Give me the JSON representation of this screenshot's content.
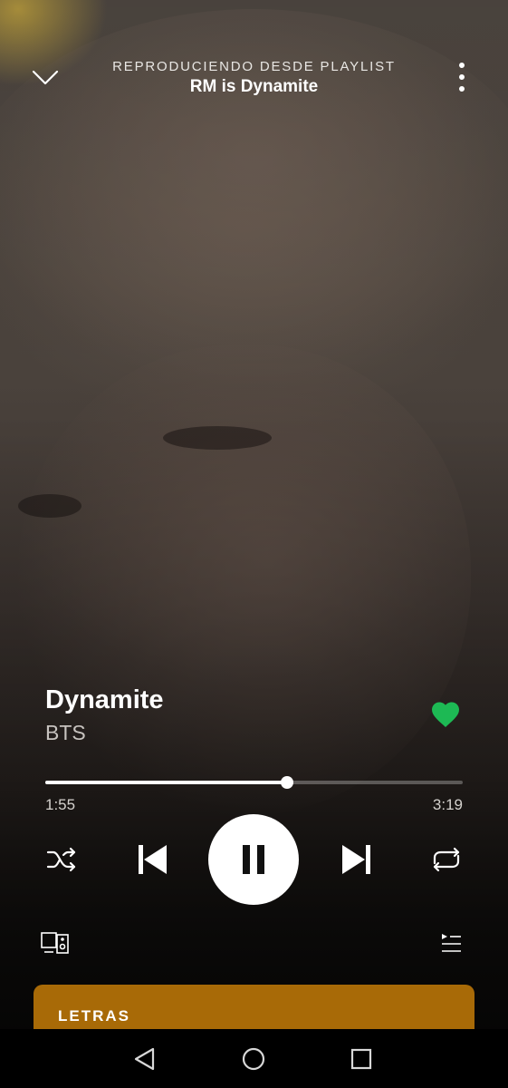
{
  "header": {
    "context_label": "REPRODUCIENDO DESDE PLAYLIST",
    "playlist_name": "RM is Dynamite",
    "collapse_icon": "chevron-down-icon",
    "more_icon": "more-vertical-icon"
  },
  "track": {
    "title": "Dynamite",
    "artist": "BTS",
    "liked": true
  },
  "progress": {
    "elapsed": "1:55",
    "total": "3:19",
    "fraction": 0.58
  },
  "controls": {
    "shuffle_icon": "shuffle-icon",
    "previous_icon": "skip-previous-icon",
    "play_state": "playing",
    "next_icon": "skip-next-icon",
    "repeat_icon": "repeat-icon",
    "devices_icon": "devices-icon",
    "queue_icon": "queue-icon"
  },
  "lyrics": {
    "label": "LETRAS"
  },
  "colors": {
    "accent_green": "#1db954",
    "lyrics_card": "#a86a07"
  },
  "navbar": {
    "icons": [
      "back-triangle-icon",
      "home-circle-icon",
      "recents-square-icon"
    ]
  }
}
